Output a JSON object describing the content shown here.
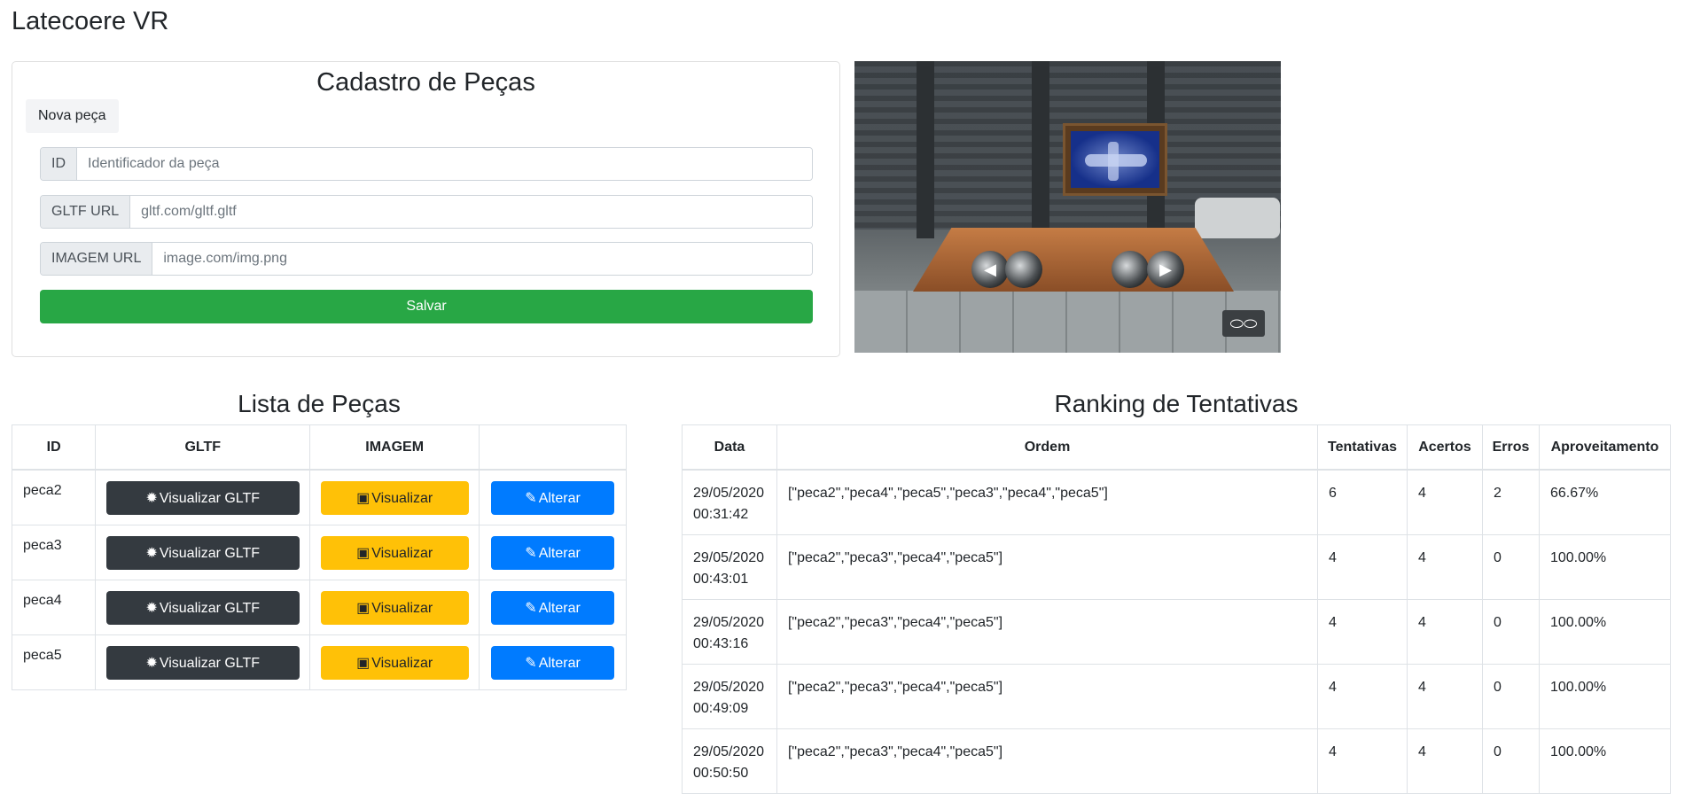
{
  "app": {
    "title": "Latecoere VR"
  },
  "cadastro": {
    "title": "Cadastro de Peças",
    "tab_label": "Nova peça",
    "fields": [
      {
        "label": "ID",
        "placeholder": "Identificador da peça",
        "value": ""
      },
      {
        "label": "GLTF URL",
        "placeholder": "gltf.com/gltf.gltf",
        "value": ""
      },
      {
        "label": "IMAGEM URL",
        "placeholder": "image.com/img.png",
        "value": ""
      }
    ],
    "save_label": "Salvar"
  },
  "vr": {
    "toggle_icon": "vr-headset-icon",
    "nav_icons": [
      "arrow-left-icon",
      "arrow-right-icon"
    ]
  },
  "lista": {
    "title": "Lista de Peças",
    "columns": [
      "ID",
      "GLTF",
      "IMAGEM",
      ""
    ],
    "rows": [
      {
        "id": "peca2",
        "gltf_label": "Visualizar GLTF",
        "image_label": "Visualizar",
        "edit_label": "Alterar"
      },
      {
        "id": "peca3",
        "gltf_label": "Visualizar GLTF",
        "image_label": "Visualizar",
        "edit_label": "Alterar"
      },
      {
        "id": "peca4",
        "gltf_label": "Visualizar GLTF",
        "image_label": "Visualizar",
        "edit_label": "Alterar"
      },
      {
        "id": "peca5",
        "gltf_label": "Visualizar GLTF",
        "image_label": "Visualizar",
        "edit_label": "Alterar"
      }
    ],
    "icons": {
      "gltf": "gear-icon",
      "image": "image-icon",
      "edit": "edit-icon"
    }
  },
  "ranking": {
    "title": "Ranking de Tentativas",
    "columns": [
      "Data",
      "Ordem",
      "Tentativas",
      "Acertos",
      "Erros",
      "Aproveitamento"
    ],
    "rows": [
      {
        "date": "29/05/2020",
        "time": "00:31:42",
        "ordem": "[\"peca2\",\"peca4\",\"peca5\",\"peca3\",\"peca4\",\"peca5\"]",
        "tentativas": "6",
        "acertos": "4",
        "erros": "2",
        "aproveitamento": "66.67%"
      },
      {
        "date": "29/05/2020",
        "time": "00:43:01",
        "ordem": "[\"peca2\",\"peca3\",\"peca4\",\"peca5\"]",
        "tentativas": "4",
        "acertos": "4",
        "erros": "0",
        "aproveitamento": "100.00%"
      },
      {
        "date": "29/05/2020",
        "time": "00:43:16",
        "ordem": "[\"peca2\",\"peca3\",\"peca4\",\"peca5\"]",
        "tentativas": "4",
        "acertos": "4",
        "erros": "0",
        "aproveitamento": "100.00%"
      },
      {
        "date": "29/05/2020",
        "time": "00:49:09",
        "ordem": "[\"peca2\",\"peca3\",\"peca4\",\"peca5\"]",
        "tentativas": "4",
        "acertos": "4",
        "erros": "0",
        "aproveitamento": "100.00%"
      },
      {
        "date": "29/05/2020",
        "time": "00:50:50",
        "ordem": "[\"peca2\",\"peca3\",\"peca4\",\"peca5\"]",
        "tentativas": "4",
        "acertos": "4",
        "erros": "0",
        "aproveitamento": "100.00%"
      }
    ]
  },
  "colors": {
    "success": "#28a745",
    "dark": "#343a40",
    "warning": "#ffc107",
    "primary": "#007bff"
  }
}
